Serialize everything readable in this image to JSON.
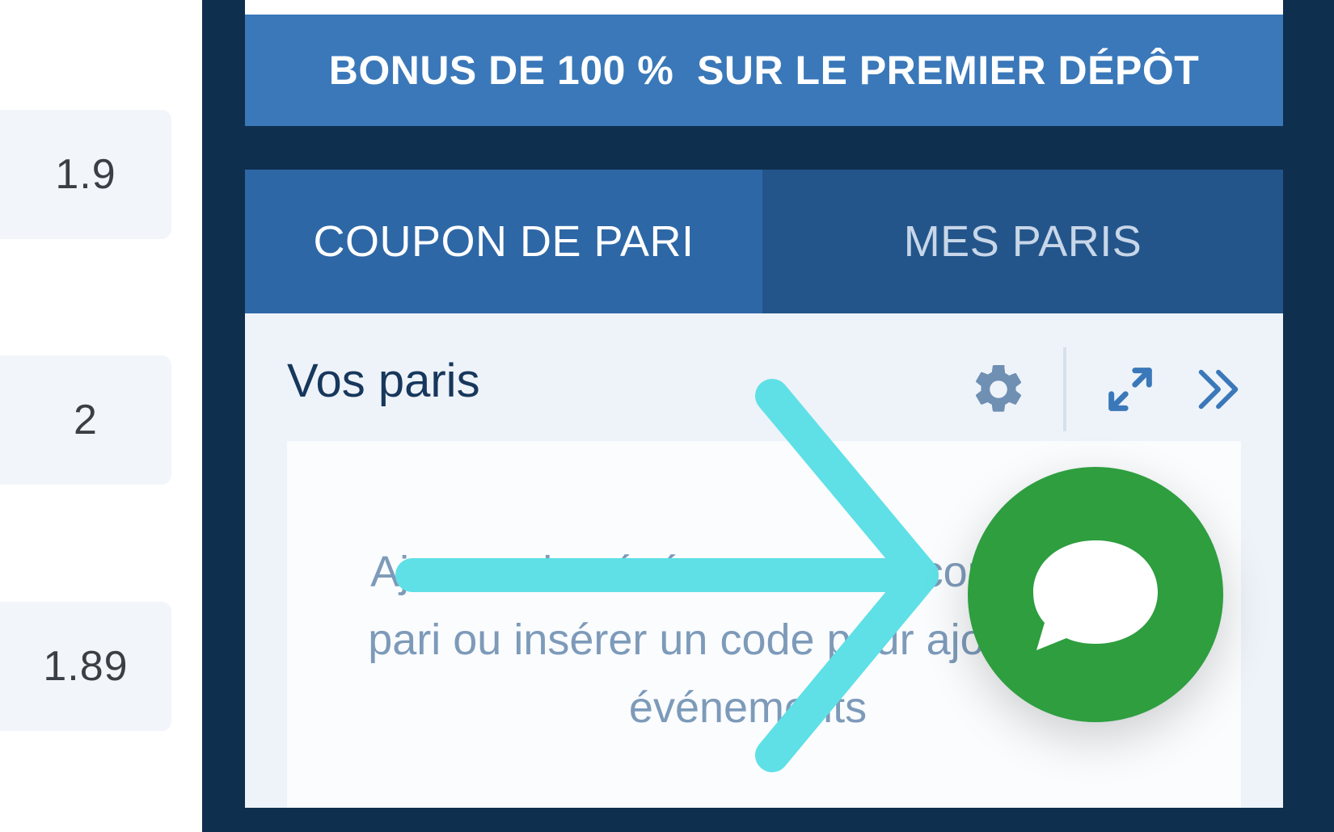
{
  "odds": [
    "1.9",
    "2",
    "1.89"
  ],
  "banner": {
    "text": "BONUS DE 100 %  SUR LE PREMIER DÉPÔT"
  },
  "tabs": [
    {
      "label": "COUPON DE PARI",
      "active": true
    },
    {
      "label": "MES PARIS",
      "active": false
    }
  ],
  "slip": {
    "title": "Vos paris",
    "empty_message": "Ajoutez des événements au coupon de pari ou insérer un code pour ajouter les événements"
  },
  "icons": {
    "settings": "gear-icon",
    "expand": "expand-icon",
    "collapse": "double-chevron-right-icon",
    "chat": "chat-bubble-icon",
    "overlay": "arrow-right-icon"
  },
  "colors": {
    "panel_bg": "#0f2f4e",
    "banner": "#3a78b9",
    "tab_active": "#2e67a6",
    "tab_inactive": "#23558a",
    "chat": "#2e9e3f",
    "overlay_arrow": "#5ee0e6"
  }
}
